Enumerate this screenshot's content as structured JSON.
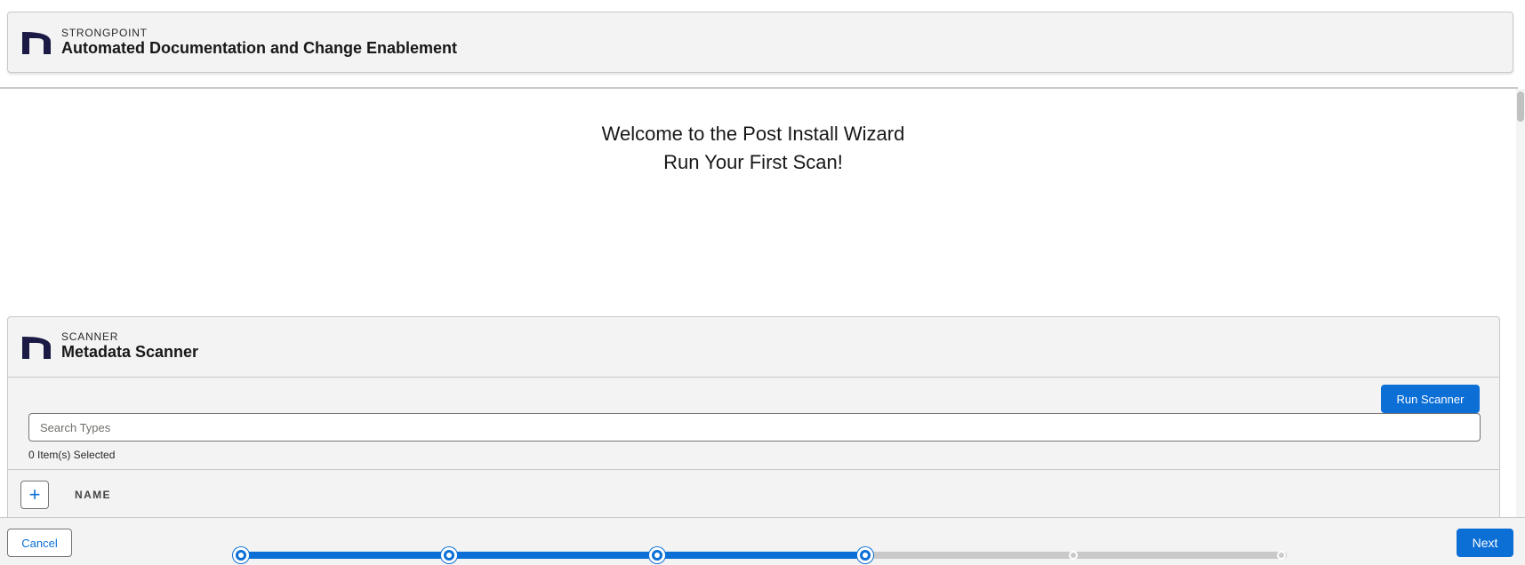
{
  "header": {
    "eyebrow": "STRONGPOINT",
    "title": "Automated Documentation and Change Enablement"
  },
  "welcome": {
    "line1": "Welcome to the Post Install Wizard",
    "line2": "Run Your First Scan!"
  },
  "scanner": {
    "eyebrow": "SCANNER",
    "title": "Metadata Scanner",
    "run_button_label": "Run Scanner",
    "search_placeholder": "Search Types",
    "search_value": "",
    "selected_count": "0 Item(s) Selected",
    "add_button_label": "+",
    "column_name": "NAME"
  },
  "footer": {
    "cancel_label": "Cancel",
    "next_label": "Next"
  },
  "progress": {
    "total_steps": 6,
    "completed_steps": 4,
    "steps": [
      {
        "state": "complete"
      },
      {
        "state": "complete"
      },
      {
        "state": "complete"
      },
      {
        "state": "current"
      },
      {
        "state": "incomplete"
      },
      {
        "state": "incomplete"
      }
    ]
  },
  "colors": {
    "brand_blue": "#0b6fd6",
    "logo_navy": "#1b1a45",
    "panel_gray": "#f3f3f3",
    "border_gray": "#c9c9c9"
  },
  "icons": {
    "brand_logo": "n-logo-icon",
    "add": "plus-icon"
  }
}
